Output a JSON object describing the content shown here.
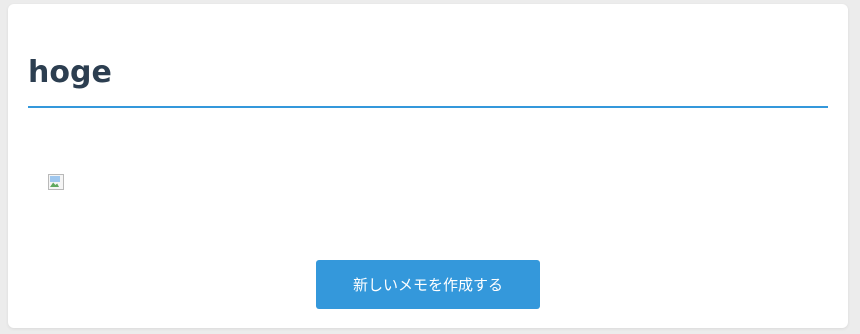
{
  "page": {
    "title": "hoge"
  },
  "actions": {
    "create_memo_label": "新しいメモを作成する"
  },
  "colors": {
    "accent": "#3498db",
    "title_text": "#2c3e50",
    "background": "#ececec",
    "card": "#ffffff"
  },
  "icons": {
    "image": "broken-image-icon"
  }
}
